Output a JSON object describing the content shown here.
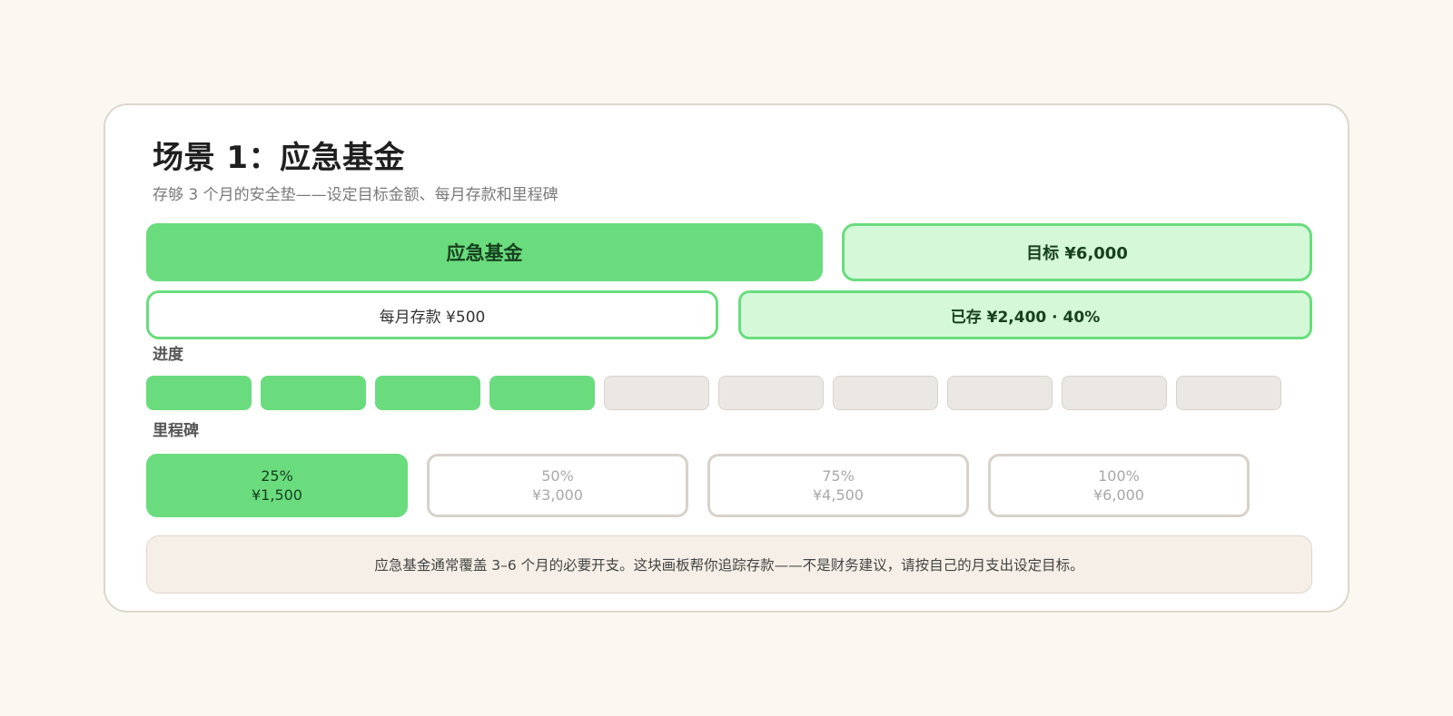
{
  "header": {
    "title": "场景 1：应急基金",
    "subtitle": "存够 3 个月的安全垫——设定目标金额、每月存款和里程碑"
  },
  "summary": {
    "fund_label": "应急基金",
    "target_label": "目标 ¥6,000",
    "monthly_label": "每月存款 ¥500",
    "saved_label": "已存 ¥2,400 · 40%"
  },
  "progress": {
    "label": "进度",
    "filled": 4,
    "total": 10,
    "fraction": 0.4
  },
  "milestones": {
    "label": "里程碑",
    "items": [
      {
        "percent": "25%",
        "amount": "¥1,500",
        "reached": true
      },
      {
        "percent": "50%",
        "amount": "¥3,000",
        "reached": false
      },
      {
        "percent": "75%",
        "amount": "¥4,500",
        "reached": false
      },
      {
        "percent": "100%",
        "amount": "¥6,000",
        "reached": false
      }
    ]
  },
  "footer_note": "应急基金通常覆盖 3–6 个月的必要开支。这块画板帮你追踪存款——不是财务建议，请按自己的月支出设定目标。",
  "colors": {
    "accent": "#6adc7e",
    "accent_light": "#d4f8d8",
    "background": "#fbf8f2",
    "empty_segment": "#ebe8e3"
  }
}
